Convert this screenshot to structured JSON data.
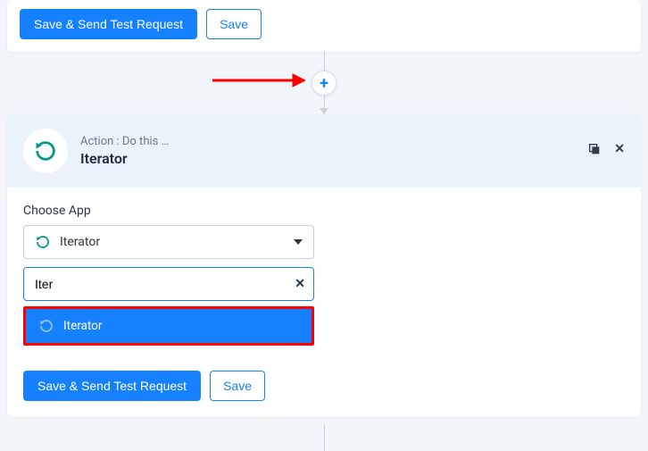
{
  "topCard": {
    "saveSend": "Save & Send Test Request",
    "save": "Save"
  },
  "actionHeader": {
    "caption": "Action : Do this …",
    "title": "Iterator"
  },
  "chooseApp": {
    "label": "Choose App",
    "selected": "Iterator",
    "searchValue": "Iter",
    "clearGlyph": "✕",
    "result": "Iterator"
  },
  "footer": {
    "saveSend": "Save & Send Test Request",
    "save": "Save"
  },
  "plusGlyph": "+",
  "closeGlyph": "✕"
}
